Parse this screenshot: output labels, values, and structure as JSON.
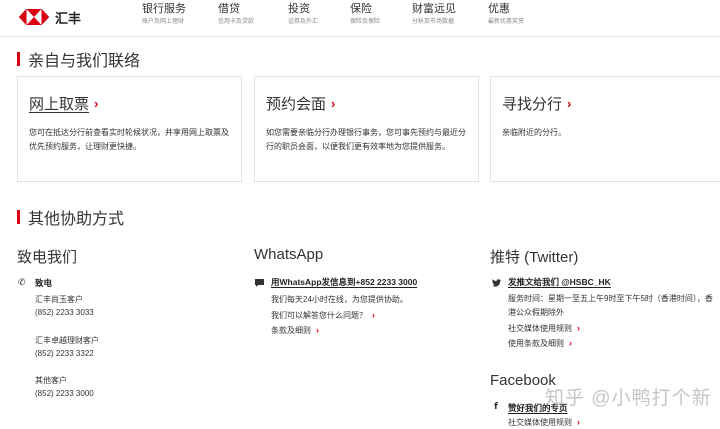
{
  "brand": {
    "name": "汇丰",
    "red": "#db0011"
  },
  "nav": [
    {
      "title": "银行服务",
      "sub": "账户及网上理财"
    },
    {
      "title": "借贷",
      "sub": "信用卡及贷款"
    },
    {
      "title": "投资",
      "sub": "证券及外汇"
    },
    {
      "title": "保险",
      "sub": "保险及保险"
    },
    {
      "title": "财富远见",
      "sub": "分析及市场数据"
    },
    {
      "title": "优惠",
      "sub": "最新优惠奖赏"
    }
  ],
  "contact": {
    "heading": "亲自与我们联络",
    "cards": [
      {
        "title": "网上取票",
        "desc": "您可在抵达分行前查看实时轮候状况，并享用网上取票及优先预约服务，让理财更快捷。"
      },
      {
        "title": "预约会面",
        "desc": "如您需要亲临分行办理银行事务，您可事先预约与最近分行的职员会面，以便我们更有效率地为您提供服务。"
      },
      {
        "title": "寻找分行",
        "desc": "亲临附近的分行。"
      }
    ]
  },
  "other": {
    "heading": "其他协助方式",
    "phone": {
      "title": "致电我们",
      "label": "致电",
      "groups": [
        {
          "name": "汇丰尚玉客户",
          "number": "(852) 2233 3033"
        },
        {
          "name": "汇丰卓越理财客户",
          "number": "(852) 2233 3322"
        },
        {
          "name": "其他客户",
          "number": "(852) 2233 3000"
        }
      ]
    },
    "whatsapp": {
      "title": "WhatsApp",
      "link": "用WhatsApp发信息到+852 2233 3000",
      "desc": "我们每天24小时在线，为您提供协助。",
      "faq": "我们可以解答您什么问题？",
      "terms": "条款及细则"
    },
    "twitter": {
      "title": "推特 (Twitter)",
      "link": "发推文给我们 @HSBC_HK",
      "hours": "服务时间：星期一至五上午9时至下午5时（香港时间），香港公众假期除外",
      "rules": "社交媒体使用规则",
      "terms": "使用条款及细则"
    },
    "facebook": {
      "title": "Facebook",
      "link": "赞好我们的专页",
      "rules": "社交媒体使用规则"
    }
  },
  "watermark": "知乎 @小鸭打个新",
  "icons": {
    "phone": "phone-icon",
    "chat": "chat-icon",
    "twitter": "twitter-icon",
    "facebook": "facebook-icon",
    "chevron": "chevron-right-icon"
  }
}
